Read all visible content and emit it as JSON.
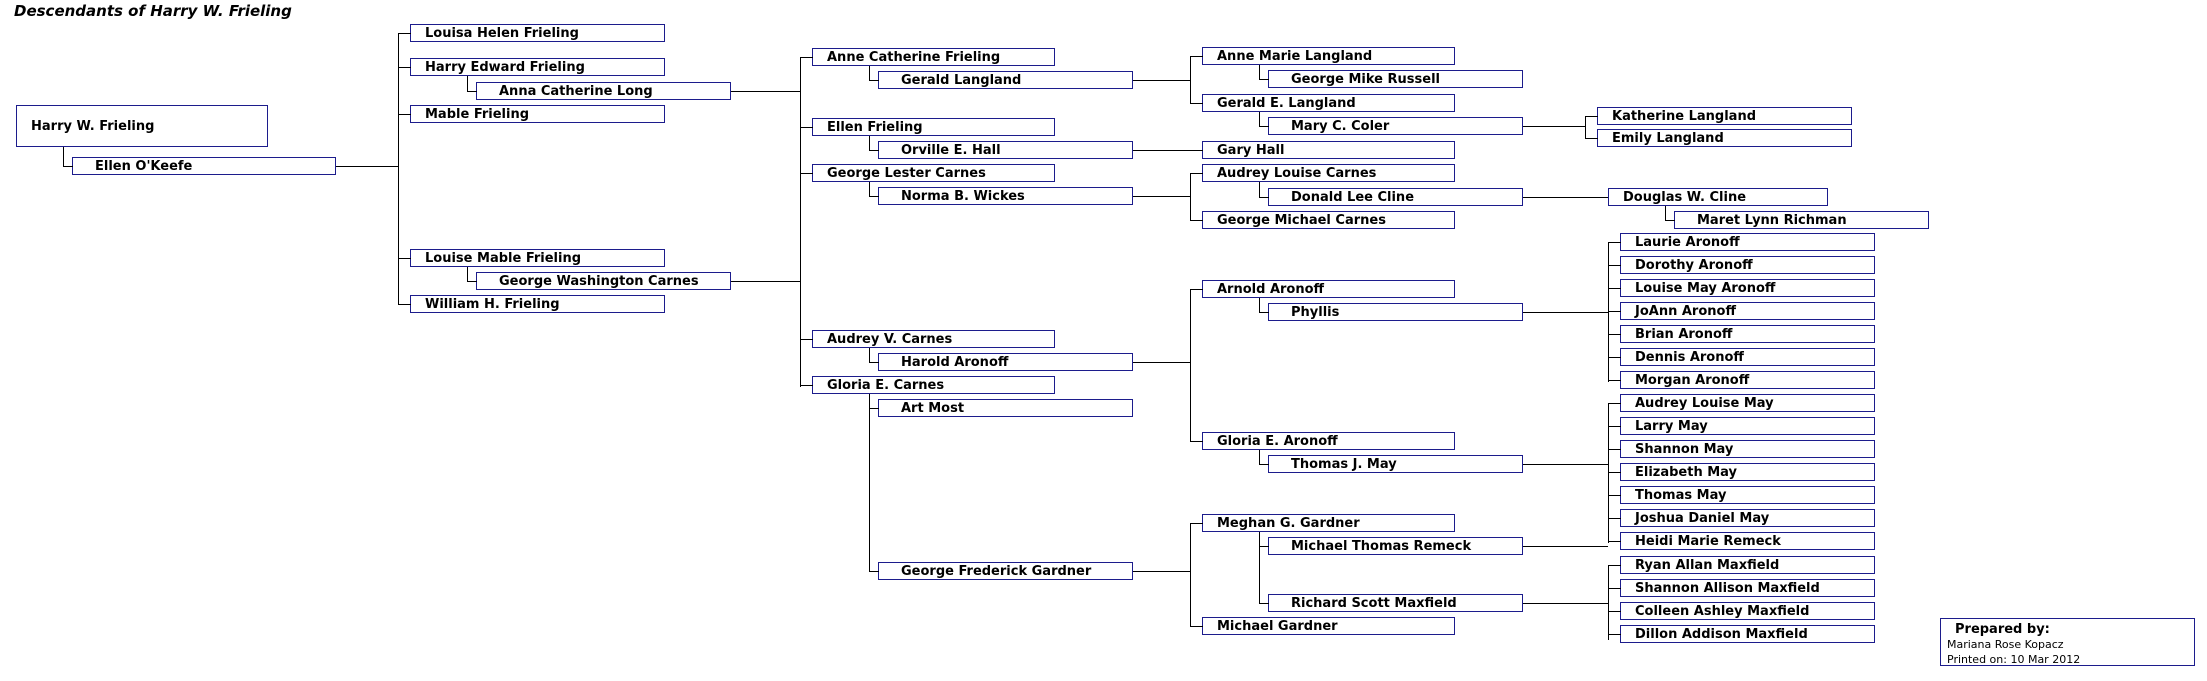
{
  "title": "Descendants of Harry W. Frieling",
  "prepared": {
    "heading": "Prepared by:",
    "author": "Mariana Rose Kopacz",
    "printed": "Printed on: 10 Mar 2012"
  },
  "colors": {
    "box_border": "#1c1c8c",
    "connector": "#000000",
    "background": "#ffffff",
    "text": "#000000"
  },
  "nodes": {
    "root": "Harry W. Frieling",
    "root_spouse": "Ellen O'Keefe",
    "gen1": [
      "Louisa Helen Frieling",
      "Harry Edward Frieling",
      "Anna Catherine Long",
      "Mable Frieling",
      "Louise Mable Frieling",
      "George Washington Carnes",
      "William H. Frieling"
    ],
    "gen2": [
      "Anne Catherine Frieling",
      "Gerald Langland",
      "Ellen Frieling",
      "Orville E. Hall",
      "George Lester Carnes",
      "Norma B. Wickes",
      "Audrey V. Carnes",
      "Harold Aronoff",
      "Gloria E. Carnes",
      "Art Most",
      "George Frederick Gardner"
    ],
    "gen3": [
      "Anne Marie Langland",
      "George Mike Russell",
      "Gerald E. Langland",
      "Mary C. Coler",
      "Gary Hall",
      "Audrey Louise Carnes",
      "Donald Lee Cline",
      "George Michael Carnes",
      "Arnold Aronoff",
      "Phyllis",
      "Gloria E. Aronoff",
      "Thomas J. May",
      "Meghan G. Gardner",
      "Michael Thomas Remeck",
      "Richard Scott Maxfield",
      "Michael Gardner"
    ],
    "gen4": [
      "Katherine Langland",
      "Emily Langland",
      "Douglas W. Cline",
      "Maret Lynn Richman",
      "Laurie Aronoff",
      "Dorothy Aronoff",
      "Louise May Aronoff",
      "JoAnn Aronoff",
      "Brian Aronoff",
      "Dennis Aronoff",
      "Morgan Aronoff",
      "Audrey Louise May",
      "Larry May",
      "Shannon May",
      "Elizabeth May",
      "Thomas May",
      "Joshua Daniel May",
      "Heidi Marie Remeck",
      "Ryan Allan Maxfield",
      "Shannon Allison Maxfield",
      "Colleen Ashley Maxfield",
      "Dillon Addison Maxfield"
    ]
  }
}
